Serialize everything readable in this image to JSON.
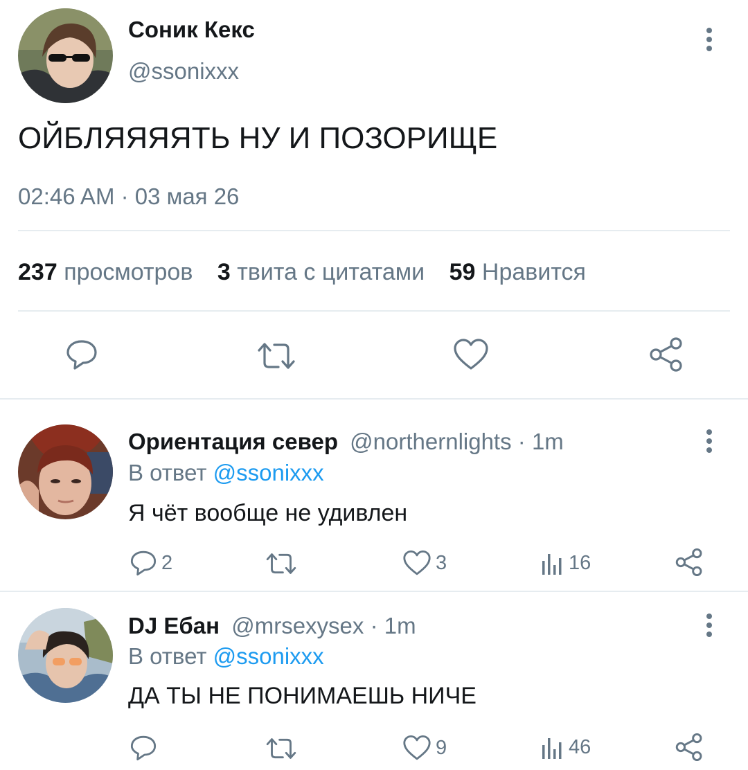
{
  "main_tweet": {
    "name": "Соник Кекс",
    "handle": "@ssonixxx",
    "text": "ОЙБЛЯЯЯЯТЬ НУ И ПОЗОРИЩЕ",
    "meta": "02:46 AM · 03 мая 26",
    "stats": {
      "views_count": "237",
      "views_label": "просмотров",
      "quotes_count": "3",
      "quotes_label": "твита с цитатами",
      "likes_count": "59",
      "likes_label": "Нравится"
    },
    "actions": [
      "reply-icon",
      "retweet-icon",
      "heart-icon",
      "share-icon"
    ]
  },
  "replies": [
    {
      "name": "Ориентация север",
      "handle": "@northernlights",
      "time": "· 1m",
      "in_reply_label": "В ответ",
      "in_reply_handle": "@ssonixxx",
      "text": "Я чёт вообще не удивлен",
      "reply_count": "2",
      "retweet_count": "",
      "like_count": "3",
      "view_count": "16"
    },
    {
      "name": "DJ Ебан",
      "handle": "@mrsexysex",
      "time": "· 1m",
      "in_reply_label": "В ответ",
      "in_reply_handle": "@ssonixxx",
      "text": "ДА ТЫ НЕ ПОНИМАЕШЬ НИЧЕ",
      "reply_count": "",
      "retweet_count": "",
      "like_count": "9",
      "view_count": "46"
    }
  ],
  "colors": {
    "accent": "#1d9bf0",
    "secondary": "#657786",
    "divider": "#e6ecf0"
  }
}
